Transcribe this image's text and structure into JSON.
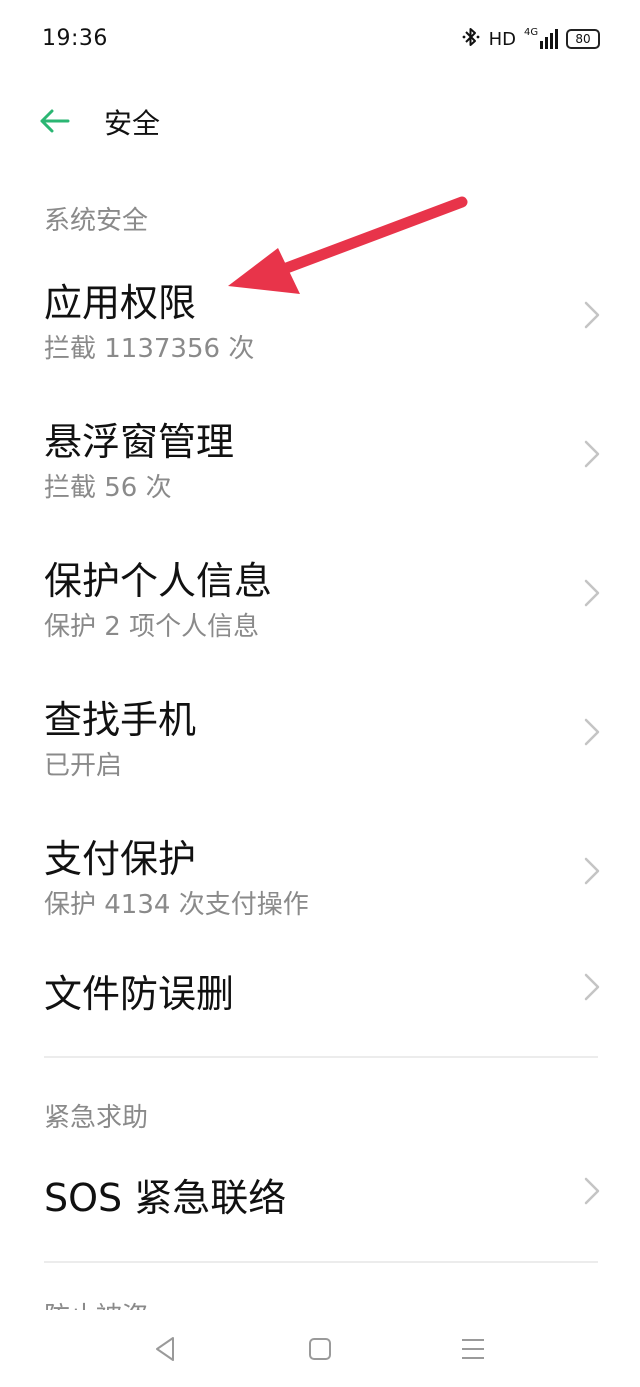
{
  "status_bar": {
    "time": "19:36",
    "bluetooth_icon": "bluetooth-icon",
    "hd_label": "HD",
    "network_label": "4G",
    "signal_icon": "signal-icon",
    "battery_level": "80"
  },
  "header": {
    "back_icon": "arrow-left-icon",
    "title": "安全",
    "accent_color": "#2bb673"
  },
  "sections": {
    "system_security": {
      "label": "系统安全",
      "items": [
        {
          "title": "应用权限",
          "subtitle": "拦截 1137356 次"
        },
        {
          "title": "悬浮窗管理",
          "subtitle": "拦截 56 次"
        },
        {
          "title": "保护个人信息",
          "subtitle": "保护 2 项个人信息"
        },
        {
          "title": "查找手机",
          "subtitle": "已开启"
        },
        {
          "title": "支付保护",
          "subtitle": "保护 4134 次支付操作"
        },
        {
          "title": "文件防误删"
        }
      ]
    },
    "emergency": {
      "label": "紧急求助",
      "items": [
        {
          "title": "SOS 紧急联络"
        }
      ]
    },
    "next_section_partial": "防止被盗"
  },
  "annotation": {
    "arrow_color": "#e8344a"
  },
  "nav_bar": {
    "back_icon": "triangle-back-icon",
    "home_icon": "square-home-icon",
    "menu_icon": "lines-menu-icon"
  }
}
